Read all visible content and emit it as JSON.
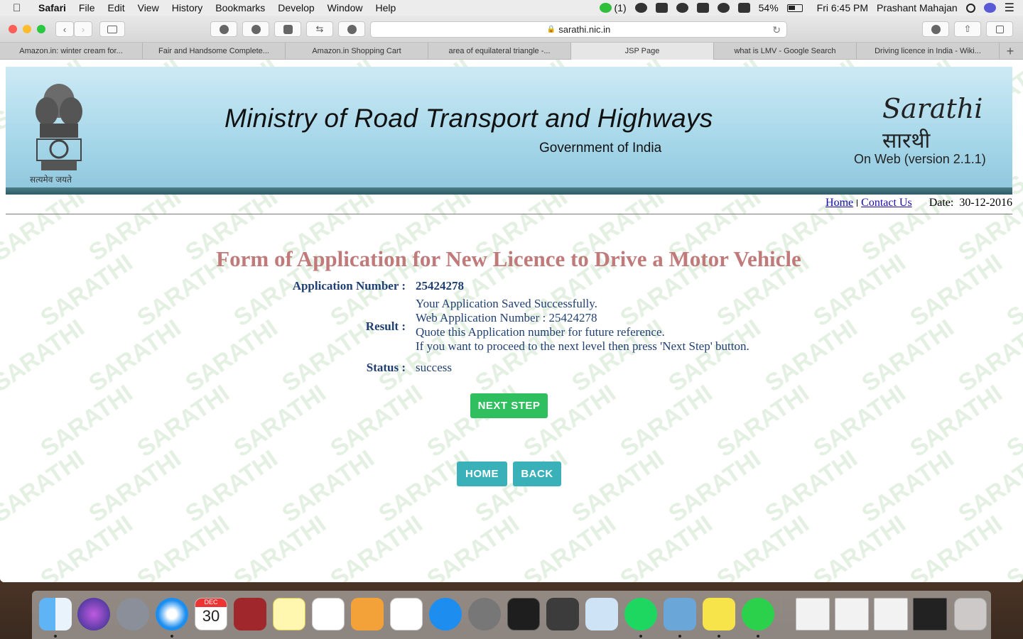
{
  "menubar": {
    "apple": "",
    "app": "Safari",
    "items": [
      "File",
      "Edit",
      "View",
      "History",
      "Bookmarks",
      "Develop",
      "Window",
      "Help"
    ],
    "notification_count": "(1)",
    "battery": "54%",
    "clock": "Fri 6:45 PM",
    "user": "Prashant  Mahajan"
  },
  "browser": {
    "url": "sarathi.nic.in",
    "tabs": [
      "Amazon.in: winter cream for...",
      "Fair and Handsome Complete...",
      "Amazon.in Shopping Cart",
      "area of equilateral triangle -...",
      "JSP Page",
      "what is LMV - Google Search",
      "Driving licence in India - Wiki..."
    ],
    "active_tab": 4,
    "new_tab": "+"
  },
  "header": {
    "emblem_caption": "सत्यमेव जयते",
    "ministry": "Ministry of Road Transport and Highways",
    "government": "Government of India",
    "logo_en": "Sarathi",
    "logo_hi": "सारथी",
    "version": "On Web (version 2.1.1)"
  },
  "nav": {
    "home": "Home",
    "contact": "Contact Us",
    "date_label": "Date:",
    "date_value": "30-12-2016"
  },
  "form": {
    "title": "Form of Application for New Licence to Drive a Motor Vehicle",
    "app_number_label": "Application Number :",
    "app_number_value": "25424278",
    "result_label": "Result :",
    "result_lines": [
      "Your Application Saved Successfully.",
      "Web Application Number : 25424278",
      "Quote this Application number for future reference.",
      "If you want to proceed to the next level then press 'Next Step' button."
    ],
    "status_label": "Status :",
    "status_value": "success",
    "next_step": "NEXT STEP",
    "home_button": "HOME",
    "back_button": "BACK"
  },
  "watermark_text": "SARATHI",
  "calendar": {
    "month": "DEC",
    "day": "30"
  },
  "dock_apps": [
    "finder",
    "siri",
    "launchpad",
    "safari",
    "calendar",
    "dictionary",
    "notes",
    "reminders",
    "pages",
    "numbers",
    "app-store",
    "system-preferences",
    "terminal",
    "sublime-text",
    "preview",
    "spotify",
    "photos",
    "stickies",
    "messages"
  ],
  "dock_windows": [
    "window-1",
    "window-2",
    "window-3",
    "window-4"
  ],
  "colors": {
    "title": "#c07a7a",
    "label": "#1f3f73",
    "next_step": "#2fbf5e",
    "nav_buttons": "#3ab0b8"
  }
}
